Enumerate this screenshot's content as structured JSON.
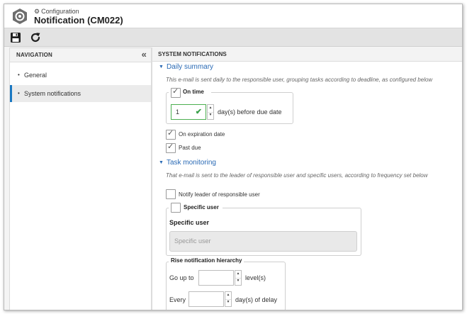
{
  "window": {
    "breadcrumb": "Configuration",
    "title": "Notification (CM022)"
  },
  "toolbar": {
    "save_icon": "save-icon",
    "refresh_icon": "refresh-icon"
  },
  "navigation": {
    "header": "NAVIGATION",
    "items": [
      {
        "label": "General",
        "active": false
      },
      {
        "label": "System notifications",
        "active": true
      }
    ]
  },
  "system_notifications": {
    "header": "SYSTEM NOTIFICATIONS",
    "daily_summary": {
      "title": "Daily summary",
      "hint": "This e-mail is sent daily to the responsible user, grouping tasks according to deadline, as configured below",
      "on_time": {
        "label": "On time",
        "checked": true,
        "days_value": "1",
        "days_suffix": "day(s) before due date"
      },
      "on_expiration_date": {
        "label": "On expiration date",
        "checked": true
      },
      "past_due": {
        "label": "Past due",
        "checked": true
      }
    },
    "task_monitoring": {
      "title": "Task monitoring",
      "hint": "That e-mail is sent to the leader of responsible user and specific users, according to frequency set below",
      "notify_leader": {
        "label": "Notify leader of responsible user",
        "checked": false
      },
      "specific_user": {
        "legend": "Specific user",
        "checked": false,
        "field_label": "Specific user",
        "placeholder": "Specific user"
      },
      "rise_hierarchy": {
        "legend": "Rise notification hierarchy",
        "go_up_label": "Go up to",
        "go_up_value": "",
        "go_up_suffix": "level(s)",
        "every_label": "Every",
        "every_value": "",
        "every_suffix": "day(s) of delay"
      }
    }
  },
  "colors": {
    "accent": "#1a78c2",
    "link": "#2a6ab5",
    "valid": "#4caf50"
  }
}
